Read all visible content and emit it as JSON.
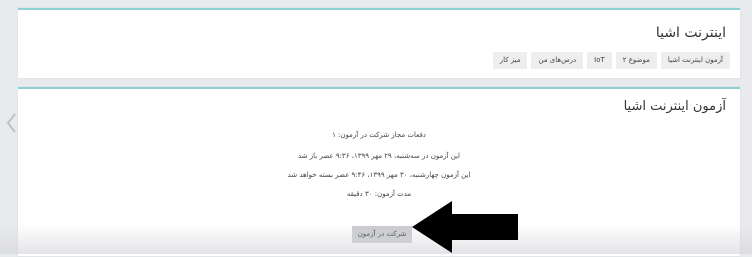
{
  "header": {
    "title": "اینترنت اشیا",
    "breadcrumb": [
      "میز کار",
      "درس‌های من",
      "IoT",
      "موضوع ۲",
      "آزمون اینترنت اشیا"
    ]
  },
  "quiz": {
    "title": "آزمون اینترنت اشیا",
    "info": [
      "دفعات مجاز شرکت در آزمون: ۱",
      "این آزمون در سه‌شنبه، ۲۹ مهر ۱۳۹۹، ۹:۳۶ عصر باز شد",
      "این آزمون چهارشنبه، ۳۰ مهر ۱۳۹۹، ۹:۴۶ عصر بسته خواهد شد",
      "مدت آزمون: ۳۰ دقیقه"
    ],
    "attempt_button": "شرکت در آزمون"
  },
  "icons": {
    "prev": "chevron-left-icon",
    "pointer": "arrow-left-icon"
  },
  "colors": {
    "accent_border": "#8fd0d6",
    "button_bg": "#c9cbcf",
    "page_bg": "#e9eaee"
  }
}
